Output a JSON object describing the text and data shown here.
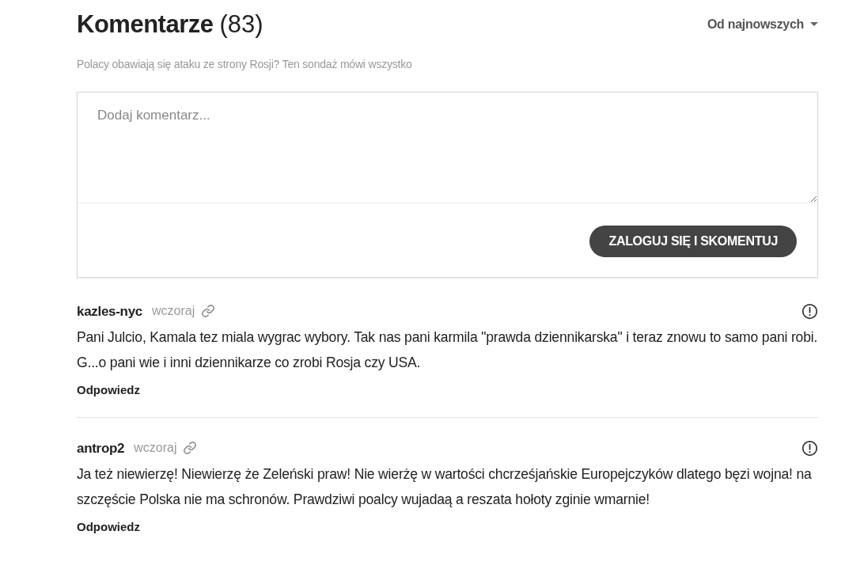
{
  "header": {
    "title": "Komentarze",
    "count": "(83)",
    "sort": "Od najnowszych",
    "subtitle": "Polacy obawiają się ataku ze strony Rosji? Ten sondaż mówi wszystko"
  },
  "form": {
    "placeholder": "Dodaj komentarz...",
    "submit": "ZALOGUJ SIĘ I SKOMENTUJ"
  },
  "comments": [
    {
      "author": "kazles-nyc",
      "time": "wczoraj",
      "text": "Pani Julcio, Kamala tez miala wygrac wybory. Tak nas pani karmila \"prawda dziennikarska\" i teraz znowu to samo pani robi. G...o pani wie i inni dziennikarze co zrobi Rosja czy USA.",
      "reply": "Odpowiedz"
    },
    {
      "author": "antrop2",
      "time": "wczoraj",
      "text": "Ja też niewierzę! Niewierzę że Zeleński praw! Nie wierżę w wartości chcrześjańskie Europejczyków dlatego bęzi wojna! na szczęście Polska nie ma schronów. Prawdziwi poalcy wujadaą a reszata hołoty zginie wmarnie!",
      "reply": "Odpowiedz"
    }
  ]
}
